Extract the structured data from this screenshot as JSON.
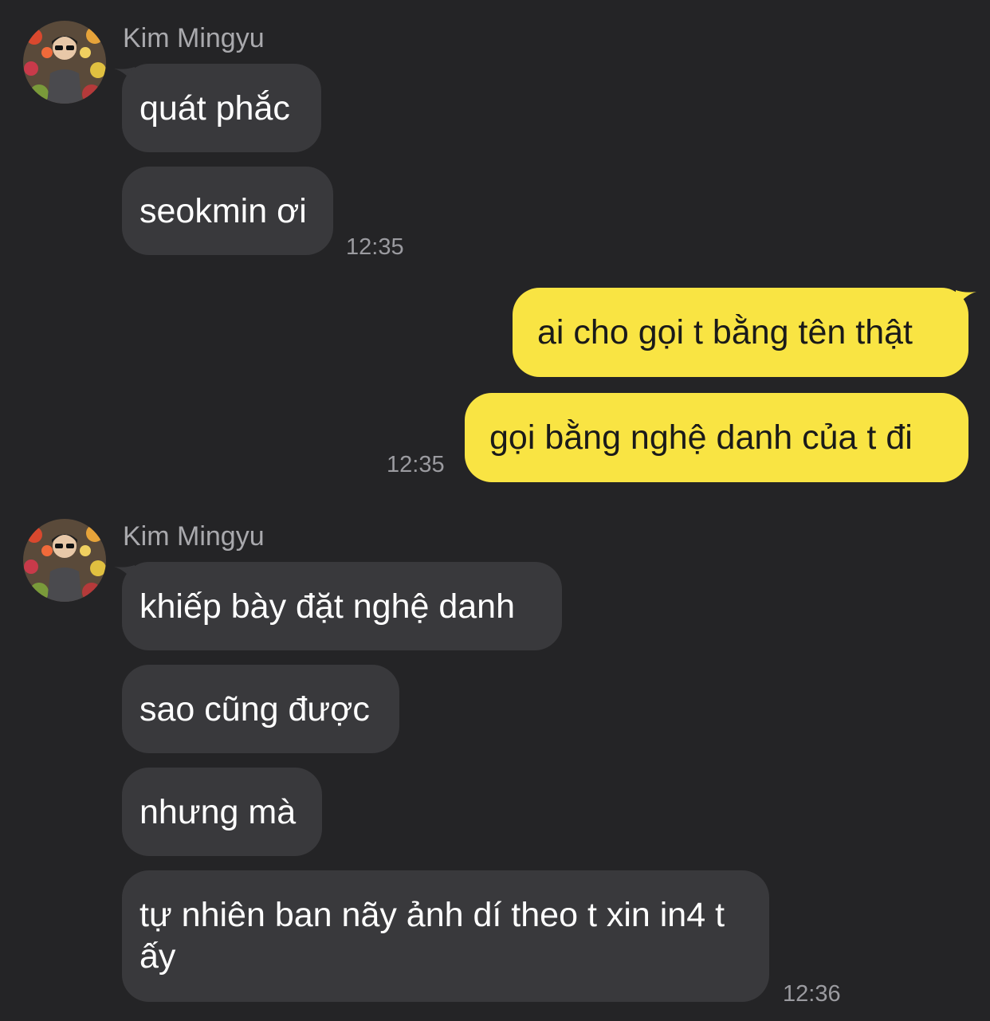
{
  "colors": {
    "background": "#242426",
    "incoming_bubble": "#39393c",
    "outgoing_bubble": "#f9e443",
    "timestamp": "#9b9ba0",
    "sender_name": "#a9a9ad"
  },
  "groups": [
    {
      "sender": "Kim Mingyu",
      "avatar": "profile-photo",
      "messages": [
        "quát phắc",
        "seokmin ơi"
      ],
      "time": "12:35"
    },
    {
      "sender": "me",
      "messages": [
        "ai cho gọi t bằng tên thật",
        "gọi bằng nghệ danh của t đi"
      ],
      "time": "12:35"
    },
    {
      "sender": "Kim Mingyu",
      "avatar": "profile-photo",
      "messages": [
        "khiếp bày đặt nghệ danh",
        "sao cũng được",
        "nhưng mà",
        "tự nhiên ban nãy ảnh dí theo t xin in4 t ấy"
      ],
      "time": "12:36"
    }
  ]
}
